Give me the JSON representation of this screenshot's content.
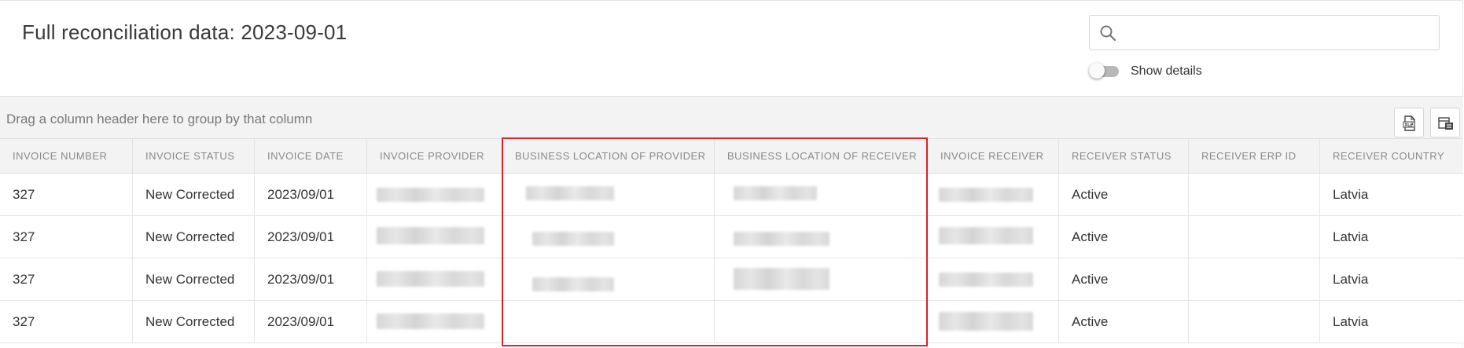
{
  "page": {
    "title": "Full reconciliation data: 2023-09-01"
  },
  "search": {
    "placeholder": "",
    "value": "",
    "icon": "search-icon"
  },
  "details_toggle": {
    "label": "Show details",
    "on": false
  },
  "group_panel": {
    "text": "Drag a column header here to group by that column"
  },
  "toolbar": {
    "buttons": [
      {
        "icon": "xlsx-export-icon"
      },
      {
        "icon": "column-chooser-icon"
      }
    ]
  },
  "table": {
    "columns": [
      "INVOICE NUMBER",
      "INVOICE STATUS",
      "INVOICE DATE",
      "INVOICE PROVIDER",
      "BUSINESS LOCATION OF PROVIDER",
      "BUSINESS LOCATION OF RECEIVER",
      "INVOICE RECEIVER",
      "RECEIVER STATUS",
      "RECEIVER ERP ID",
      "RECEIVER COUNTRY"
    ],
    "rows": [
      [
        "327",
        "New Corrected",
        "2023/09/01",
        "",
        "",
        "",
        "",
        "Active",
        "",
        "Latvia"
      ],
      [
        "327",
        "New Corrected",
        "2023/09/01",
        "",
        "",
        "",
        "",
        "Active",
        "",
        "Latvia"
      ],
      [
        "327",
        "New Corrected",
        "2023/09/01",
        "",
        "",
        "",
        "",
        "Active",
        "",
        "Latvia"
      ],
      [
        "327",
        "New Corrected",
        "2023/09/01",
        "",
        "",
        "",
        "",
        "Active",
        "",
        "Latvia"
      ]
    ]
  },
  "colors": {
    "highlight": "#d9232d",
    "header_bg": "#f3f3f3",
    "border": "#e6e6e6"
  }
}
